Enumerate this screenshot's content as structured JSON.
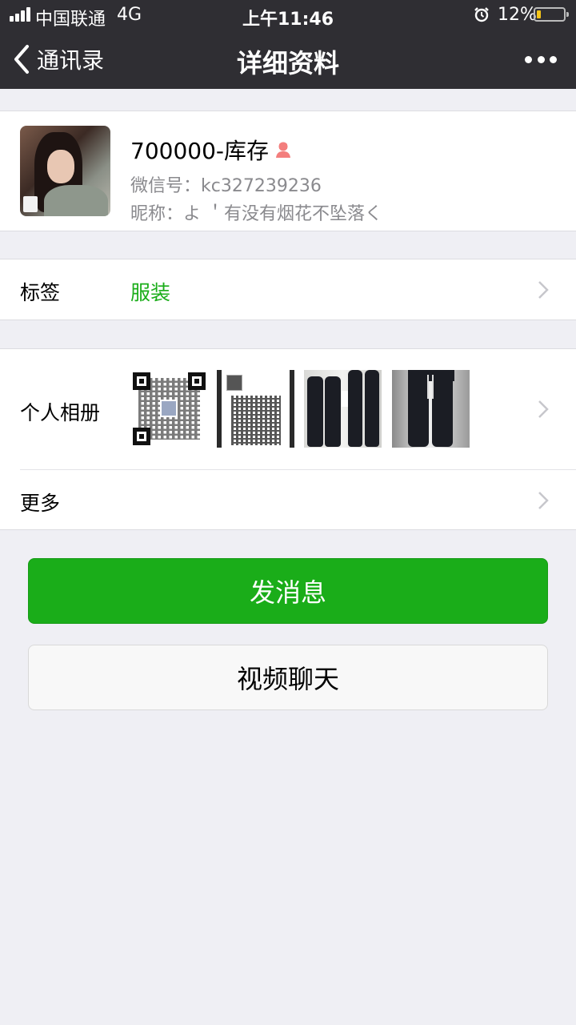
{
  "status_bar": {
    "carrier": "中国联通",
    "network": "4G",
    "time": "上午11:46",
    "battery_percent": "12%",
    "battery_level": 0.12,
    "battery_color": "#f5c518"
  },
  "nav": {
    "back_label": "通讯录",
    "title": "详细资料",
    "more_icon": "more-icon"
  },
  "profile": {
    "name": "700000-库存",
    "gender_icon": "female-icon",
    "wechat_id": "微信号：kc327239236",
    "nickname": "昵称：よ ＇有没有烟花不坠落く"
  },
  "tag_row": {
    "label": "标签",
    "value": "服装",
    "value_color": "#1aad19"
  },
  "album_row": {
    "label": "个人相册",
    "thumbnails": [
      "qr-code-image",
      "qr-card-image",
      "black-pants-image",
      "black-pants-detail-image"
    ]
  },
  "more_row": {
    "label": "更多"
  },
  "actions": {
    "send_message": "发消息",
    "video_call": "视频聊天",
    "primary_color": "#1aad19"
  }
}
